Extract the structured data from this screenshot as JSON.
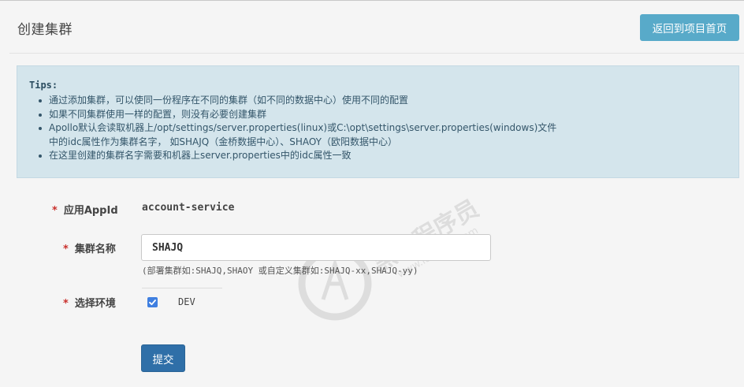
{
  "header": {
    "title": "创建集群",
    "back_button_label": "返回到项目首页"
  },
  "tips": {
    "title": "Tips:",
    "items": [
      "通过添加集群，可以使同一份程序在不同的集群（如不同的数据中心）使用不同的配置",
      "如果不同集群使用一样的配置，则没有必要创建集群",
      "Apollo默认会读取机器上/opt/settings/server.properties(linux)或C:\\opt\\settings\\server.properties(windows)文件",
      "中的idc属性作为集群名字， 如SHAJQ（金桥数据中心）、SHAOY（欧阳数据中心）",
      "在这里创建的集群名字需要和机器上server.properties中的idc属性一致"
    ]
  },
  "form": {
    "required_mark": "*",
    "appid": {
      "label": "应用AppId",
      "value": "account-service"
    },
    "cluster_name": {
      "label": "集群名称",
      "value": "SHAJQ",
      "hint": "(部署集群如:SHAJQ,SHAOY 或自定义集群如:SHAJQ-xx,SHAJQ-yy)"
    },
    "environment": {
      "label": "选择环境",
      "options": [
        {
          "label": "DEV",
          "checked": true
        }
      ]
    },
    "submit_label": "提交"
  },
  "watermark": {
    "text": "黑马程序员",
    "subtext": "www.itheima.com"
  },
  "colors": {
    "primary_button": "#2f6fa8",
    "info_button": "#58aac9",
    "tips_background": "#d4e5ec",
    "required": "#c9302c",
    "checkbox": "#3f7fe0"
  }
}
